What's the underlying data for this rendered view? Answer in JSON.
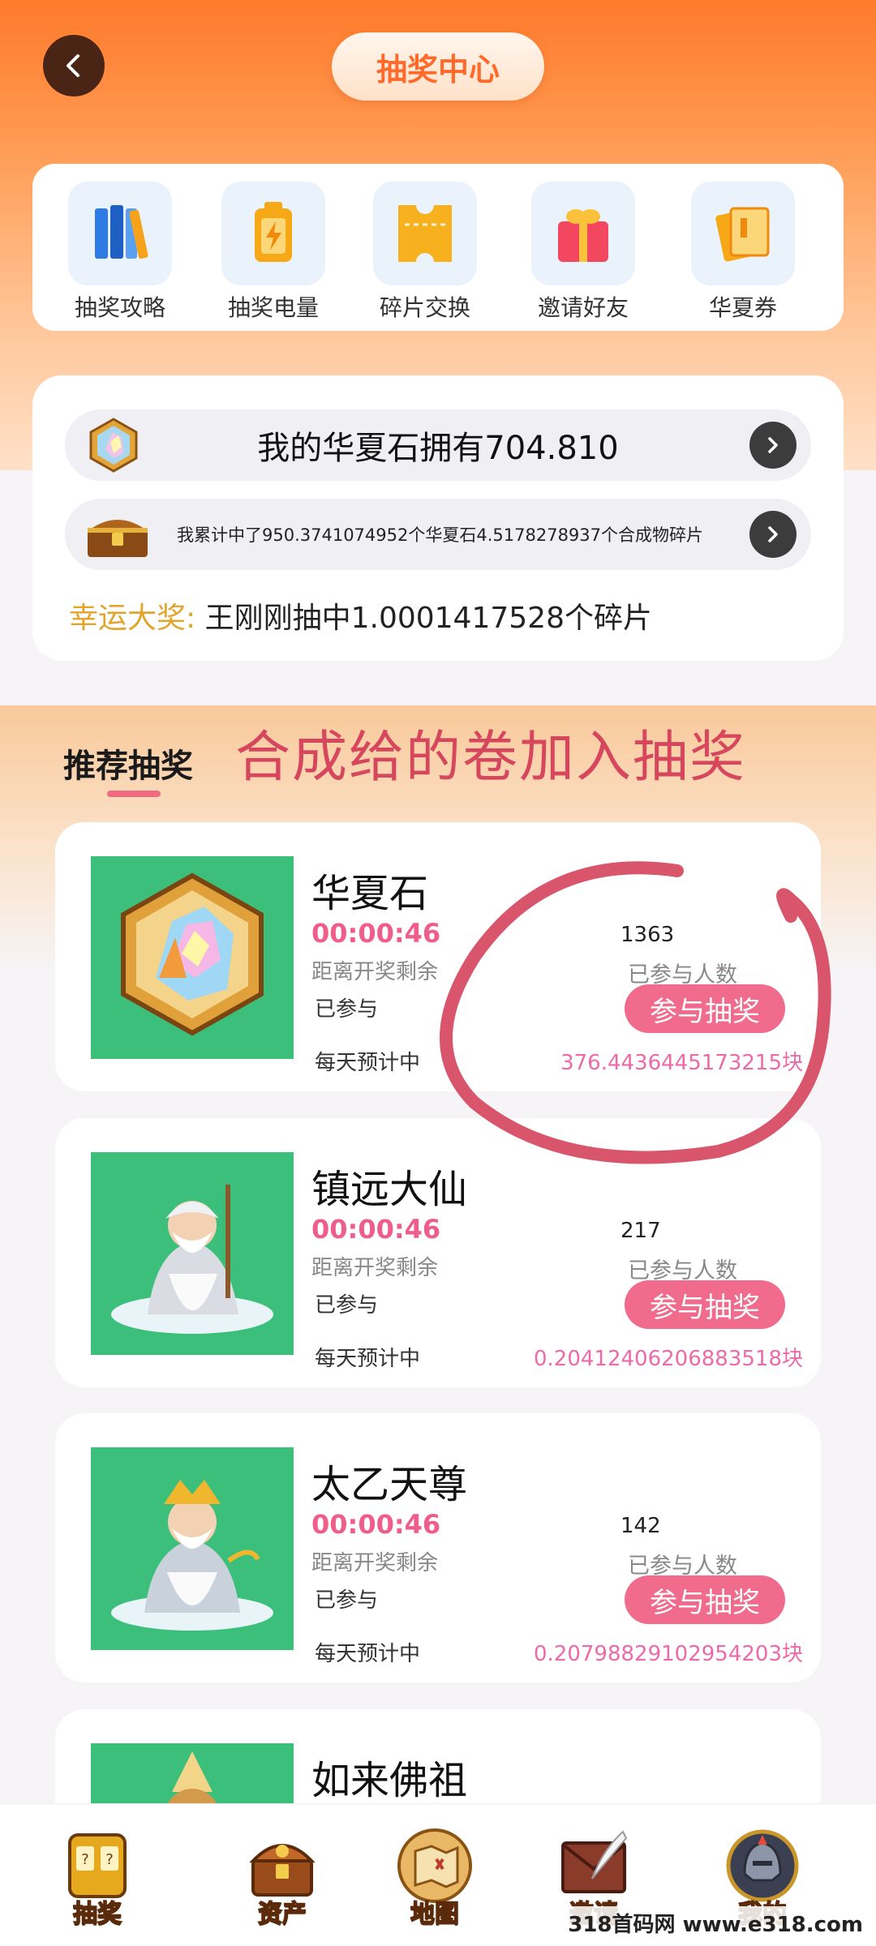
{
  "header": {
    "title": "抽奖中心",
    "back_icon": "chevron-left-icon"
  },
  "quick_menu": [
    {
      "label": "抽奖攻略",
      "icon": "books-icon"
    },
    {
      "label": "抽奖电量",
      "icon": "battery-icon"
    },
    {
      "label": "碎片交换",
      "icon": "ticket-icon"
    },
    {
      "label": "邀请好友",
      "icon": "gift-icon"
    },
    {
      "label": "华夏券",
      "icon": "coupon-icon"
    }
  ],
  "wallet": {
    "stone_text": "我的华夏石拥有704.810",
    "accumulated_text": "我累计中了950.3741074952个华夏石4.5178278937个合成物碎片",
    "lucky_label": "幸运大奖:",
    "lucky_text": "王刚刚抽中1.0001417528个碎片"
  },
  "section": {
    "title": "推荐抽奖",
    "handwritten_note": "合成给的卷加入抽奖"
  },
  "lots": [
    {
      "name": "华夏石",
      "timer": "00:00:46",
      "timer_label": "距离开奖剩余",
      "joined_label": "已参与",
      "participants": "1363",
      "participants_label": "已参与人数",
      "button": "参与抽奖",
      "daily_label": "每天预计中",
      "amount": "376.4436445173215块"
    },
    {
      "name": "镇远大仙",
      "timer": "00:00:46",
      "timer_label": "距离开奖剩余",
      "joined_label": "已参与",
      "participants": "217",
      "participants_label": "已参与人数",
      "button": "参与抽奖",
      "daily_label": "每天预计中",
      "amount": "0.20412406206883518块"
    },
    {
      "name": "太乙天尊",
      "timer": "00:00:46",
      "timer_label": "距离开奖剩余",
      "joined_label": "已参与",
      "participants": "142",
      "participants_label": "已参与人数",
      "button": "参与抽奖",
      "daily_label": "每天预计中",
      "amount": "0.20798829102954203块"
    },
    {
      "name": "如来佛祖"
    }
  ],
  "bottom_nav": [
    {
      "label": "抽奖",
      "icon": "slot-machine-icon"
    },
    {
      "label": "资产",
      "icon": "treasure-chest-icon"
    },
    {
      "label": "地图",
      "icon": "map-scroll-icon"
    },
    {
      "label": "邀请",
      "icon": "quill-letter-icon"
    },
    {
      "label": "我的",
      "icon": "helmet-icon"
    }
  ],
  "watermark": "318首码网 www.e318.com",
  "colors": {
    "accent_orange": "#ff7a2b",
    "pink_button": "#f06b8c",
    "timer_pink": "#ef5d8a",
    "annotation_red": "#d6475e"
  }
}
